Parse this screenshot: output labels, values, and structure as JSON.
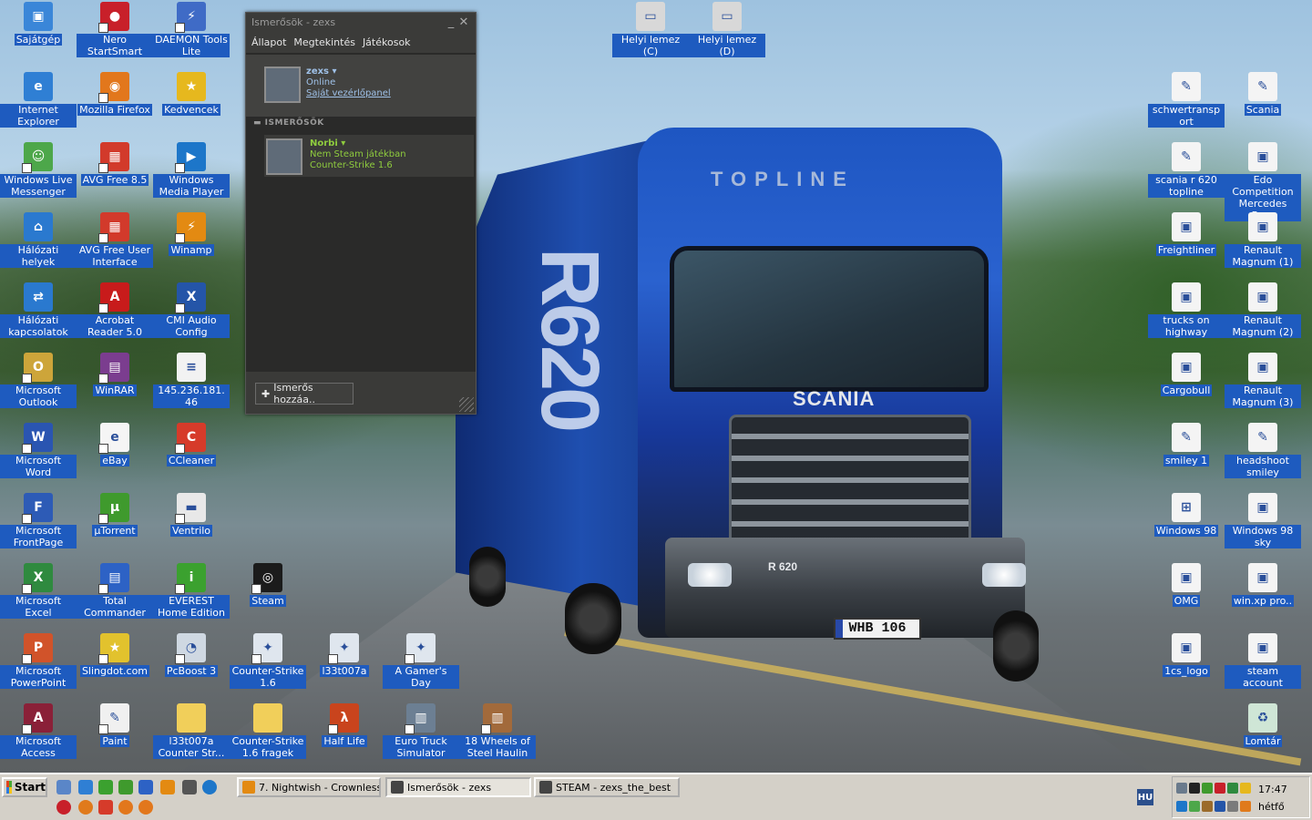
{
  "desktop": {
    "icons": [
      {
        "id": "sajatgep",
        "label": "Sajátgép",
        "color": "#3a86d8",
        "glyph": "▣"
      },
      {
        "id": "nero",
        "label": "Nero StartSmart",
        "color": "#c8202a",
        "glyph": "●"
      },
      {
        "id": "daemon",
        "label": "DAEMON Tools Lite",
        "color": "#3f6bc6",
        "glyph": "⚡"
      },
      {
        "id": "ie",
        "label": "Internet Explorer",
        "color": "#2f7fd4",
        "glyph": "e"
      },
      {
        "id": "firefox",
        "label": "Mozilla Firefox",
        "color": "#e2771c",
        "glyph": "◉"
      },
      {
        "id": "kedvencek",
        "label": "Kedvencek",
        "color": "#e6b81e",
        "glyph": "★"
      },
      {
        "id": "wlm",
        "label": "Windows Live Messenger",
        "color": "#4da74a",
        "glyph": "☺"
      },
      {
        "id": "avg",
        "label": "AVG Free 8.5",
        "color": "#d23a2b",
        "glyph": "▦"
      },
      {
        "id": "wmp",
        "label": "Windows Media Player",
        "color": "#1d76c9",
        "glyph": "▶"
      },
      {
        "id": "halozati_helyek",
        "label": "Hálózati helyek",
        "color": "#2a79cf",
        "glyph": "⌂"
      },
      {
        "id": "avg_ui",
        "label": "AVG Free User Interface",
        "color": "#d23a2b",
        "glyph": "▦"
      },
      {
        "id": "winamp",
        "label": "Winamp",
        "color": "#e38a12",
        "glyph": "⚡"
      },
      {
        "id": "halozati_kapcs",
        "label": "Hálózati kapcsolatok",
        "color": "#2a79cf",
        "glyph": "⇄"
      },
      {
        "id": "acrobat",
        "label": "Acrobat Reader 5.0",
        "color": "#c81b1b",
        "glyph": "A"
      },
      {
        "id": "cmi",
        "label": "CMI Audio Config",
        "color": "#2455a8",
        "glyph": "X"
      },
      {
        "id": "outlook",
        "label": "Microsoft Outlook",
        "color": "#cda53a",
        "glyph": "O"
      },
      {
        "id": "winrar",
        "label": "WinRAR",
        "color": "#7b3d8f",
        "glyph": "▤"
      },
      {
        "id": "ip",
        "label": "145.236.181.46",
        "color": "#f2f2f2",
        "glyph": "≡"
      },
      {
        "id": "word",
        "label": "Microsoft Word",
        "color": "#2a55b1",
        "glyph": "W"
      },
      {
        "id": "ebay",
        "label": "eBay",
        "color": "#f5f5f5",
        "glyph": "e"
      },
      {
        "id": "ccleaner",
        "label": "CCleaner",
        "color": "#d63b2a",
        "glyph": "C"
      },
      {
        "id": "frontpage",
        "label": "Microsoft FrontPage",
        "color": "#2d5bb6",
        "glyph": "F"
      },
      {
        "id": "utorrent",
        "label": "µTorrent",
        "color": "#3f9a2d",
        "glyph": "µ"
      },
      {
        "id": "ventrilo",
        "label": "Ventrilo",
        "color": "#e8e8e8",
        "glyph": "▬"
      },
      {
        "id": "excel",
        "label": "Microsoft Excel",
        "color": "#2f8a3f",
        "glyph": "X"
      },
      {
        "id": "totalcmd",
        "label": "Total Commander",
        "color": "#2d62c5",
        "glyph": "▤"
      },
      {
        "id": "everest",
        "label": "EVEREST Home Edition",
        "color": "#3ba12f",
        "glyph": "i"
      },
      {
        "id": "steam",
        "label": "Steam",
        "color": "#1b1b1b",
        "glyph": "◎"
      },
      {
        "id": "powerpoint",
        "label": "Microsoft PowerPoint",
        "color": "#d1532a",
        "glyph": "P"
      },
      {
        "id": "slingdot",
        "label": "Slingdot.com",
        "color": "#e2c22d",
        "glyph": "★"
      },
      {
        "id": "pcboost",
        "label": "PcBoost 3",
        "color": "#cfd8e2",
        "glyph": "◔"
      },
      {
        "id": "cs16",
        "label": "Counter-Strike 1.6",
        "color": "#dfe6ee",
        "glyph": "✦"
      },
      {
        "id": "l33t",
        "label": "l33t007a",
        "color": "#dfe6ee",
        "glyph": "✦"
      },
      {
        "id": "gamersday",
        "label": "A Gamer's Day",
        "color": "#dfe6ee",
        "glyph": "✦"
      },
      {
        "id": "access",
        "label": "Microsoft Access",
        "color": "#8a2038",
        "glyph": "A"
      },
      {
        "id": "paint",
        "label": "Paint",
        "color": "#f0f0f0",
        "glyph": "✎"
      },
      {
        "id": "l33t_folder",
        "label": "l33t007a Counter Str...",
        "color": "#f1cf5a",
        "glyph": ""
      },
      {
        "id": "cs_folder",
        "label": "Counter-Strike 1.6 fragek",
        "color": "#f1cf5a",
        "glyph": ""
      },
      {
        "id": "halflife",
        "label": "Half Life",
        "color": "#c9441d",
        "glyph": "λ"
      },
      {
        "id": "ets",
        "label": "Euro Truck Simulator",
        "color": "#6c7f93",
        "glyph": "▥"
      },
      {
        "id": "18wheels",
        "label": "18 Wheels of Steel Haulin",
        "color": "#a26a3b",
        "glyph": "▥"
      },
      {
        "id": "helyi_c",
        "label": "Helyi lemez (C)",
        "color": "#d8d8d8",
        "glyph": "▭"
      },
      {
        "id": "helyi_d",
        "label": "Helyi lemez (D)",
        "color": "#d8d8d8",
        "glyph": "▭"
      },
      {
        "id": "schwert",
        "label": "schwertransport",
        "color": "#f4f4f4",
        "glyph": "✎"
      },
      {
        "id": "scania",
        "label": "Scania",
        "color": "#f4f4f4",
        "glyph": "✎"
      },
      {
        "id": "scania_r620",
        "label": "scania r 620 topline",
        "color": "#f4f4f4",
        "glyph": "✎"
      },
      {
        "id": "edo",
        "label": "Edo Competition Mercedes Be...",
        "color": "#f4f4f4",
        "glyph": "▣"
      },
      {
        "id": "freightliner",
        "label": "Freightliner",
        "color": "#f4f4f4",
        "glyph": "▣"
      },
      {
        "id": "renault1",
        "label": "Renault Magnum (1)",
        "color": "#f4f4f4",
        "glyph": "▣"
      },
      {
        "id": "trucks_hw",
        "label": "trucks on highway",
        "color": "#f4f4f4",
        "glyph": "▣"
      },
      {
        "id": "renault2",
        "label": "Renault Magnum (2)",
        "color": "#f4f4f4",
        "glyph": "▣"
      },
      {
        "id": "cargobull",
        "label": "Cargobull",
        "color": "#f4f4f4",
        "glyph": "▣"
      },
      {
        "id": "renault3",
        "label": "Renault Magnum (3)",
        "color": "#f4f4f4",
        "glyph": "▣"
      },
      {
        "id": "smiley1",
        "label": "smiley 1",
        "color": "#f4f4f4",
        "glyph": "✎"
      },
      {
        "id": "headshoot",
        "label": "headshoot smiley",
        "color": "#f4f4f4",
        "glyph": "✎"
      },
      {
        "id": "win98",
        "label": "Windows 98",
        "color": "#f4f4f4",
        "glyph": "⊞"
      },
      {
        "id": "win98sky",
        "label": "Windows 98 sky",
        "color": "#f4f4f4",
        "glyph": "▣"
      },
      {
        "id": "omg",
        "label": "OMG",
        "color": "#f4f4f4",
        "glyph": "▣"
      },
      {
        "id": "winxp",
        "label": "win.xp pro..",
        "color": "#f4f4f4",
        "glyph": "▣"
      },
      {
        "id": "cs_logo",
        "label": "1cs_logo",
        "color": "#f4f4f4",
        "glyph": "▣"
      },
      {
        "id": "steam_acc",
        "label": "steam account",
        "color": "#f4f4f4",
        "glyph": "▣"
      },
      {
        "id": "lomtar",
        "label": "Lomtár",
        "color": "#cfe6d6",
        "glyph": "♻"
      }
    ]
  },
  "wallpaper": {
    "topline": "TOPLINE",
    "brand": "SCANIA",
    "model": "R 620",
    "plate": "WHB 106",
    "trailer": "R620"
  },
  "friends": {
    "title": "Ismerősök - zexs",
    "minimize": "_",
    "close": "✕",
    "menu": [
      "Állapot",
      "Megtekintés",
      "Játékosok"
    ],
    "me": {
      "name": "zexs",
      "status": "Online",
      "link": "Saját vezérlőpanel"
    },
    "section": "ISMERŐSÖK",
    "friend": {
      "name": "Norbi",
      "status": "Nem Steam játékban",
      "game": "Counter-Strike 1.6"
    },
    "add_button": "Ismerős hozzáa.."
  },
  "taskbar": {
    "start": "Start",
    "buttons": [
      {
        "label": "7. Nightwish - Crownless...",
        "active": false
      },
      {
        "label": "Ismerősök - zexs",
        "active": true
      },
      {
        "label": "STEAM - zexs_the_best",
        "active": false
      }
    ],
    "lang": "HU",
    "time": "17:47",
    "day": "hétfő"
  }
}
